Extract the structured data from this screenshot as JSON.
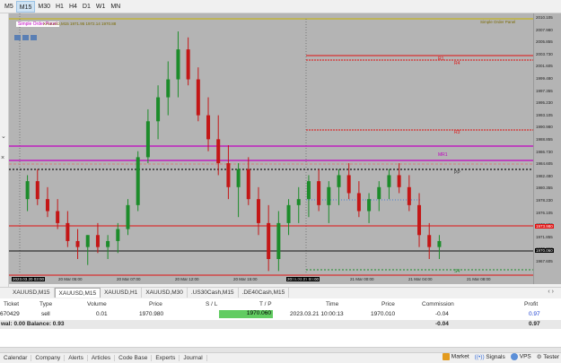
{
  "timeframes": [
    "M5",
    "M15",
    "M30",
    "H1",
    "H4",
    "D1",
    "W1",
    "MN"
  ],
  "active_timeframe": "M15",
  "chart": {
    "overlay_label": "Simple Order Panel",
    "top_left_info": "XAUUSD,M15 1971.95 1972.14 1970.88",
    "levels": {
      "r1": "R1",
      "r4": "R4",
      "r3": "R3",
      "mr1": "MR1",
      "pp": "PP",
      "s1": "S1",
      "s4": "S4"
    },
    "price_labels": [
      "2010.105",
      "2007.980",
      "2005.855",
      "2003.730",
      "2001.605",
      "1999.480",
      "1997.355",
      "1995.230",
      "1993.105",
      "1990.980",
      "1988.855",
      "1986.730",
      "1984.605",
      "1982.480",
      "1980.355",
      "1978.230",
      "1976.105",
      "1973.980",
      "1971.855",
      "1970.060",
      "1967.605"
    ],
    "current_price": "1973.980",
    "line_price": "1970.060",
    "time_labels": [
      "20 Mar 05:00",
      "20 Mar 07:00",
      "20 Mar 12:00",
      "20 Mar 15:00",
      "20 Mar 19:00",
      "21 Mar 00:00",
      "21 Mar 04:00",
      "21 Mar 08:00"
    ],
    "first_time_label": "2023.03.20 03:00",
    "cursor_time_label": "2023.03.21 00:00",
    "colors": {
      "bg": "#b4b4b4",
      "bull": "#1c8c2a",
      "bear": "#c41616",
      "resist": "#e01010",
      "magenta": "#c000c0"
    }
  },
  "chart_tabs": [
    "XAUUSD,M15",
    "XAUUSD,M15",
    "XAUUSD,H1",
    "XAUUSD,M30",
    ".US30Cash,M15",
    ".DE40Cash,M15"
  ],
  "active_chart_tab_index": 1,
  "trade_table": {
    "headers": [
      "Ticket",
      "Type",
      "Volume",
      "Price",
      "S / L",
      "T / P",
      "Time",
      "Price",
      "Commission",
      "Profit"
    ],
    "row": {
      "ticket": "670429",
      "type": "sell",
      "volume": "0.01",
      "price": "1970.980",
      "sl": "",
      "tp": "1970.060",
      "time": "2023.03.21 10:00:13",
      "cur_price": "1970.010",
      "commission": "-0.04",
      "profit": "0.97"
    },
    "balance_row": {
      "label": "wal: 0.00  Balance: 0.93",
      "commission": "-0.04",
      "profit": "0.97"
    }
  },
  "toolbox_tabs": [
    "Calendar",
    "Company",
    "Alerts",
    "Articles",
    "Code Base",
    "Experts",
    "Journal"
  ],
  "status": {
    "market": "Market",
    "signals": "Signals",
    "vps": "VPS",
    "tester": "Tester"
  }
}
